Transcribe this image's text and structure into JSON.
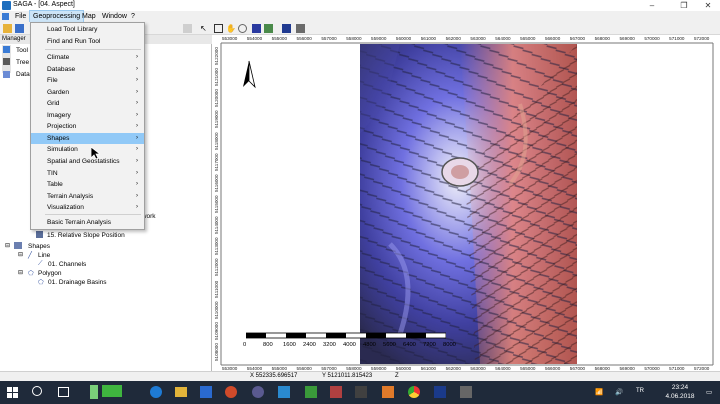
{
  "window": {
    "title": "SAGA - [04. Aspect]"
  },
  "menubar": {
    "items": [
      "File",
      "Geoprocessing",
      "Map",
      "Window",
      "?"
    ]
  },
  "left_panel": {
    "header": "Manager",
    "tabs": [
      "Tool",
      "Tree",
      "Data"
    ],
    "tree": {
      "network_suffix": "twork",
      "grid_item": "15. Relative Slope Position",
      "shapes": "Shapes",
      "line": "Line",
      "channels": "01. Channels",
      "polygon": "Polygon",
      "basins": "01. Drainage Basins"
    }
  },
  "dropdown": {
    "top_items": [
      "Load Tool Library",
      "Find and Run Tool"
    ],
    "submenus": [
      "Climate",
      "Database",
      "File",
      "Garden",
      "Grid",
      "Imagery",
      "Projection",
      "Shapes",
      "Simulation",
      "Spatial and Geostatistics",
      "TIN",
      "Table",
      "Terrain Analysis",
      "Visualization"
    ],
    "bottom_items": [
      "Basic Terrain Analysis"
    ],
    "highlighted": "Shapes"
  },
  "map": {
    "x_ticks": [
      "553000",
      "554000",
      "555000",
      "556000",
      "557000",
      "558000",
      "559000",
      "560000",
      "561000",
      "562000",
      "563000",
      "564000",
      "565000",
      "566000",
      "567000",
      "568000",
      "569000",
      "570000",
      "571000",
      "572000"
    ],
    "y_ticks": [
      "5122000",
      "5121000",
      "5120000",
      "5119000",
      "5118000",
      "5117000",
      "5116000",
      "5115000",
      "5114000",
      "5113000",
      "5112000",
      "5111000",
      "5110000",
      "5109000",
      "5108000"
    ],
    "scalebar_labels": [
      "0",
      "800",
      "1600",
      "2400",
      "3200",
      "4000",
      "4800",
      "5600",
      "6400",
      "7200",
      "8000"
    ],
    "north_label": "N"
  },
  "statusbar": {
    "x": "X 552335.696517",
    "y": "Y 5121011.815423",
    "z": "Z"
  },
  "taskbar": {
    "time": "23:24",
    "date": "4.06.2018"
  },
  "colors": {
    "hillshade_warm": "#f08a7c",
    "hillshade_cool": "#7878f0",
    "highlight": "#91c9f7"
  }
}
